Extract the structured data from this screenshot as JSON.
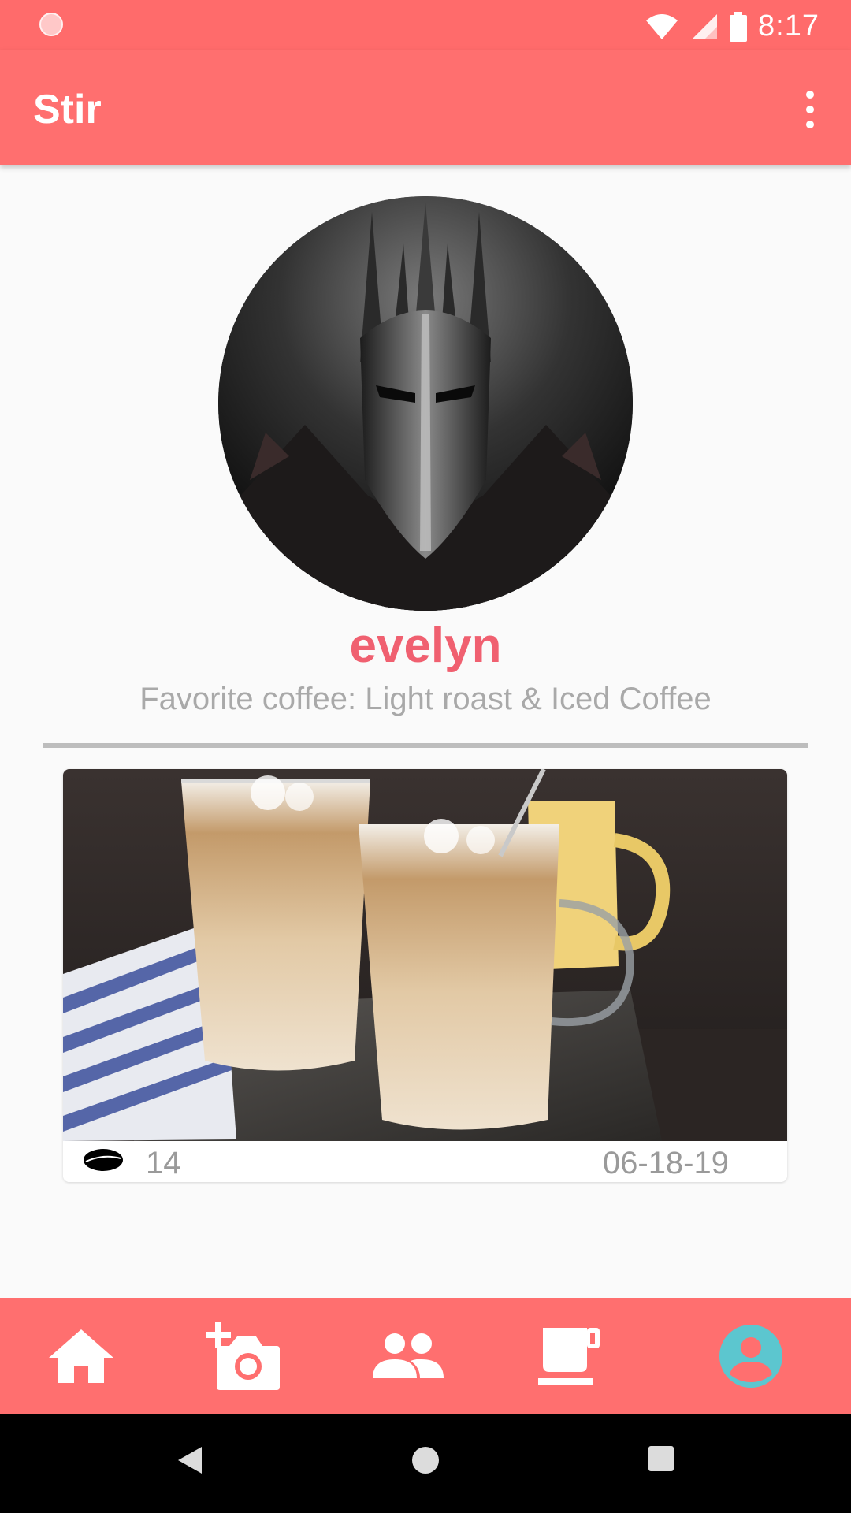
{
  "status_bar": {
    "time": "8:17"
  },
  "app_bar": {
    "title": "Stir"
  },
  "profile": {
    "username": "evelyn",
    "favorite_coffee": "Favorite coffee: Light roast & Iced Coffee"
  },
  "posts": [
    {
      "likes": "14",
      "date": "06-18-19",
      "image": "iced-coffee-photo"
    }
  ],
  "bottom_nav": {
    "items": [
      {
        "icon": "home-icon",
        "active": false
      },
      {
        "icon": "add-photo-icon",
        "active": false
      },
      {
        "icon": "people-icon",
        "active": false
      },
      {
        "icon": "coffee-cup-icon",
        "active": false
      },
      {
        "icon": "profile-icon",
        "active": true
      }
    ],
    "active_color": "#5cc6cf"
  },
  "colors": {
    "primary": "#ff6f6f",
    "accent_text": "#f06070"
  }
}
